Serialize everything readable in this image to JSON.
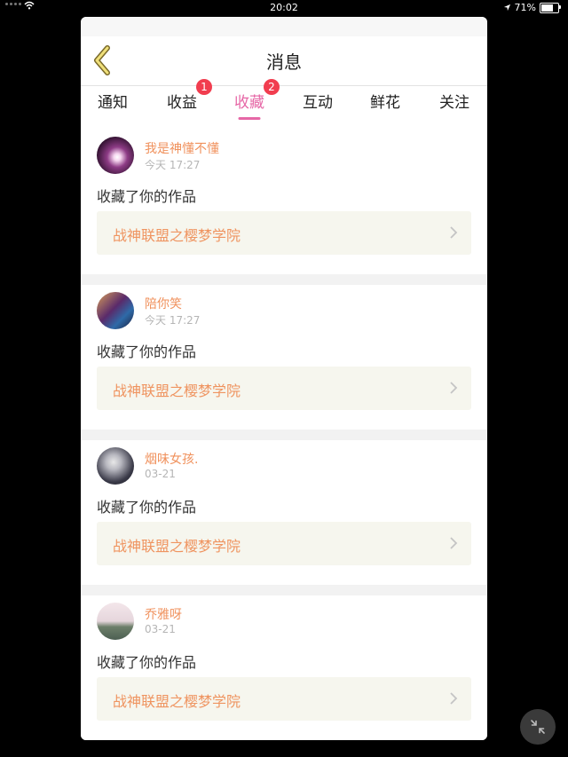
{
  "status": {
    "time": "20:02",
    "battery": "71%",
    "battery_level": 0.71
  },
  "nav": {
    "title": "消息"
  },
  "tabs": [
    {
      "label": "通知"
    },
    {
      "label": "收益",
      "badge": "1"
    },
    {
      "label": "收藏",
      "badge": "2",
      "active": true
    },
    {
      "label": "互动"
    },
    {
      "label": "鲜花"
    },
    {
      "label": "关注"
    }
  ],
  "messages": [
    {
      "username": "我是神懂不懂",
      "time": "今天 17:27",
      "action": "收藏了你的作品",
      "work": "战神联盟之樱梦学院"
    },
    {
      "username": "陪你笑",
      "time": "今天 17:27",
      "action": "收藏了你的作品",
      "work": "战神联盟之樱梦学院"
    },
    {
      "username": "烟味女孩.",
      "time": "03-21",
      "action": "收藏了你的作品",
      "work": "战神联盟之樱梦学院"
    },
    {
      "username": "乔雅呀",
      "time": "03-21",
      "action": "收藏了你的作品",
      "work": "战神联盟之樱梦学院"
    }
  ],
  "colors": {
    "accent": "#e667a6",
    "badge": "#f13d4f",
    "username": "#f0915c",
    "link_bg": "#f6f6ee"
  },
  "icons": [
    "back-arrow-icon",
    "chevron-right-icon",
    "shrink-icon",
    "wifi-icon",
    "location-arrow-icon",
    "battery-icon"
  ]
}
